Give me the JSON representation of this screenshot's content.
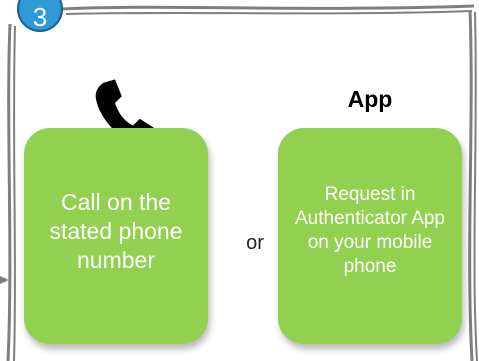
{
  "step": {
    "number": "3"
  },
  "options": {
    "call": {
      "label": "Call on the stated phone number",
      "icon": "phone-icon"
    },
    "separator": "or",
    "app": {
      "title": "App",
      "label": "Request in Authenticator App on your mobile phone"
    }
  },
  "colors": {
    "card_fill": "#92d050",
    "badge_fill": "#2e9bd8",
    "frame_stroke": "#7f7f7f"
  }
}
